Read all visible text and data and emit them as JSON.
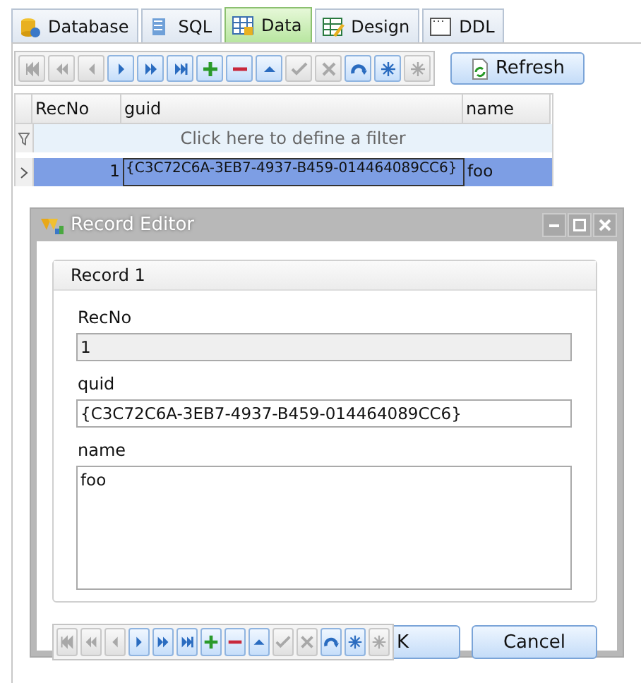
{
  "tabs": [
    {
      "label": "Database",
      "selected": false
    },
    {
      "label": "SQL",
      "selected": false
    },
    {
      "label": "Data",
      "selected": true
    },
    {
      "label": "Design",
      "selected": false
    },
    {
      "label": "DDL",
      "selected": false
    }
  ],
  "navigator": [
    {
      "kind": "first",
      "disabled": true
    },
    {
      "kind": "prior-page",
      "disabled": true
    },
    {
      "kind": "prior",
      "disabled": true
    },
    {
      "kind": "next",
      "disabled": false
    },
    {
      "kind": "next-page",
      "disabled": false
    },
    {
      "kind": "last",
      "disabled": false
    },
    {
      "kind": "insert",
      "disabled": false
    },
    {
      "kind": "delete",
      "disabled": false
    },
    {
      "kind": "edit",
      "disabled": false
    },
    {
      "kind": "post",
      "disabled": true
    },
    {
      "kind": "cancel",
      "disabled": true
    },
    {
      "kind": "refresh",
      "disabled": false
    },
    {
      "kind": "bookmark",
      "disabled": false
    },
    {
      "kind": "goto-bookmark",
      "disabled": true
    }
  ],
  "refresh_button": "Refresh",
  "grid": {
    "columns": [
      "RecNo",
      "guid",
      "name"
    ],
    "filter_hint": "Click here to define a filter",
    "rows": [
      {
        "selected": true,
        "cells": [
          "1",
          "{C3C72C6A-3EB7-4937-B459-014464089CC6}",
          "foo"
        ]
      }
    ]
  },
  "record_editor": {
    "title": "Record Editor",
    "group_title": "Record 1",
    "fields": [
      {
        "label": "RecNo",
        "value": "1",
        "kind": "readonly"
      },
      {
        "label": "quid",
        "value": "{C3C72C6A-3EB7-4937-B459-014464089CC6}",
        "kind": "edit"
      },
      {
        "label": "name",
        "value": "foo",
        "kind": "memo"
      }
    ],
    "navigator": [
      {
        "kind": "first",
        "disabled": true
      },
      {
        "kind": "prior-page",
        "disabled": true
      },
      {
        "kind": "prior",
        "disabled": true
      },
      {
        "kind": "next",
        "disabled": false
      },
      {
        "kind": "next-page",
        "disabled": false
      },
      {
        "kind": "last",
        "disabled": false
      },
      {
        "kind": "insert",
        "disabled": false
      },
      {
        "kind": "delete",
        "disabled": false
      },
      {
        "kind": "edit",
        "disabled": false
      },
      {
        "kind": "post",
        "disabled": true
      },
      {
        "kind": "cancel",
        "disabled": true
      },
      {
        "kind": "refresh",
        "disabled": false
      },
      {
        "kind": "bookmark",
        "disabled": false
      },
      {
        "kind": "goto-bookmark",
        "disabled": true
      }
    ],
    "buttons": [
      "K",
      "Cancel"
    ]
  }
}
